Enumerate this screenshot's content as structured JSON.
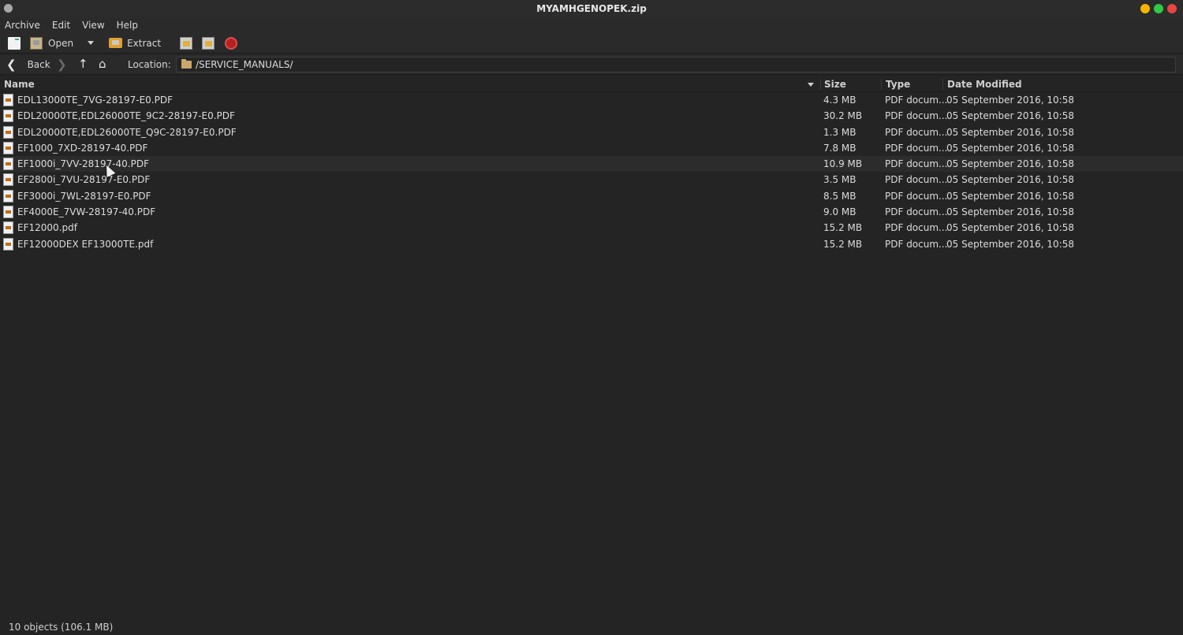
{
  "window": {
    "title": "MYAMHGENOPEK.zip"
  },
  "menu": [
    "Archive",
    "Edit",
    "View",
    "Help"
  ],
  "toolbar": {
    "open_label": "Open",
    "extract_label": "Extract"
  },
  "location": {
    "back_label": "Back",
    "label": "Location:",
    "path": "/SERVICE_MANUALS/"
  },
  "columns": {
    "name": "Name",
    "size": "Size",
    "type": "Type",
    "modified": "Date Modified"
  },
  "files": [
    {
      "name": "EDL13000TE_7VG-28197-E0.PDF",
      "size": "4.3 MB",
      "type": "PDF docum...",
      "modified": "05 September 2016, 10:58"
    },
    {
      "name": "EDL20000TE,EDL26000TE_9C2-28197-E0.PDF",
      "size": "30.2 MB",
      "type": "PDF docum...",
      "modified": "05 September 2016, 10:58"
    },
    {
      "name": "EDL20000TE,EDL26000TE_Q9C-28197-E0.PDF",
      "size": "1.3 MB",
      "type": "PDF docum...",
      "modified": "05 September 2016, 10:58"
    },
    {
      "name": "EF1000_7XD-28197-40.PDF",
      "size": "7.8 MB",
      "type": "PDF docum...",
      "modified": "05 September 2016, 10:58"
    },
    {
      "name": "EF1000i_7VV-28197-40.PDF",
      "size": "10.9 MB",
      "type": "PDF docum...",
      "modified": "05 September 2016, 10:58"
    },
    {
      "name": "EF2800i_7VU-28197-E0.PDF",
      "size": "3.5 MB",
      "type": "PDF docum...",
      "modified": "05 September 2016, 10:58"
    },
    {
      "name": "EF3000i_7WL-28197-E0.PDF",
      "size": "8.5 MB",
      "type": "PDF docum...",
      "modified": "05 September 2016, 10:58"
    },
    {
      "name": "EF4000E_7VW-28197-40.PDF",
      "size": "9.0 MB",
      "type": "PDF docum...",
      "modified": "05 September 2016, 10:58"
    },
    {
      "name": "EF12000.pdf",
      "size": "15.2 MB",
      "type": "PDF docum...",
      "modified": "05 September 2016, 10:58"
    },
    {
      "name": "EF12000DEX EF13000TE.pdf",
      "size": "15.2 MB",
      "type": "PDF docum...",
      "modified": "05 September 2016, 10:58"
    }
  ],
  "status": {
    "text": "10 objects (106.1 MB)"
  },
  "icons": {
    "new_archive": "new-archive-icon",
    "open": "open-icon",
    "extract": "extract-icon",
    "add_files": "add-files-icon",
    "add_folder": "add-folder-icon",
    "stop": "stop-icon",
    "back": "back-arrow-icon",
    "forward": "forward-arrow-icon",
    "up": "up-arrow-icon",
    "home": "home-icon",
    "folder": "folder-icon",
    "file": "pdf-file-icon"
  },
  "colors": {
    "background": "#242424",
    "bar": "#2a2a2a",
    "text": "#dcdcdc",
    "minimize": "#f4b400",
    "maximize": "#2ecc40",
    "close": "#e84545",
    "stop": "#b82020"
  }
}
